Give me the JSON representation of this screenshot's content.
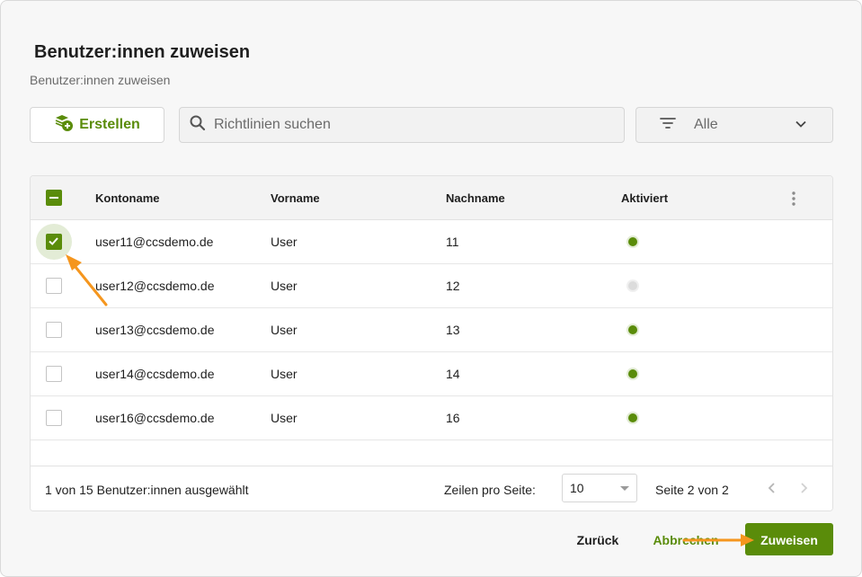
{
  "dialog": {
    "title": "Benutzer:innen zuweisen",
    "subtitle": "Benutzer:innen zuweisen"
  },
  "toolbar": {
    "create_label": "Erstellen",
    "search_placeholder": "Richtlinien suchen",
    "filter_value": "Alle"
  },
  "table": {
    "columns": [
      "Kontoname",
      "Vorname",
      "Nachname",
      "Aktiviert"
    ],
    "rows": [
      {
        "account": "user11@ccsdemo.de",
        "first": "User",
        "last": "11",
        "active": true,
        "selected": true
      },
      {
        "account": "user12@ccsdemo.de",
        "first": "User",
        "last": "12",
        "active": false,
        "selected": false
      },
      {
        "account": "user13@ccsdemo.de",
        "first": "User",
        "last": "13",
        "active": true,
        "selected": false
      },
      {
        "account": "user14@ccsdemo.de",
        "first": "User",
        "last": "14",
        "active": true,
        "selected": false
      },
      {
        "account": "user16@ccsdemo.de",
        "first": "User",
        "last": "16",
        "active": true,
        "selected": false
      }
    ]
  },
  "footer": {
    "selection_info": "1 von 15 Benutzer:innen ausgewählt",
    "rows_per_page_label": "Zeilen pro Seite:",
    "rows_per_page_value": "10",
    "page_info": "Seite 2 von 2"
  },
  "actions": {
    "back_label": "Zurück",
    "cancel_label": "Abbrechen",
    "assign_label": "Zuweisen"
  },
  "colors": {
    "accent": "#5a8c0a",
    "annotation_arrow": "#f5961e"
  },
  "icons": [
    "create-stack-plus-icon",
    "search-icon",
    "filter-lines-icon",
    "chevron-down-icon",
    "more-vertical-icon",
    "chevron-left-icon",
    "chevron-right-icon"
  ]
}
